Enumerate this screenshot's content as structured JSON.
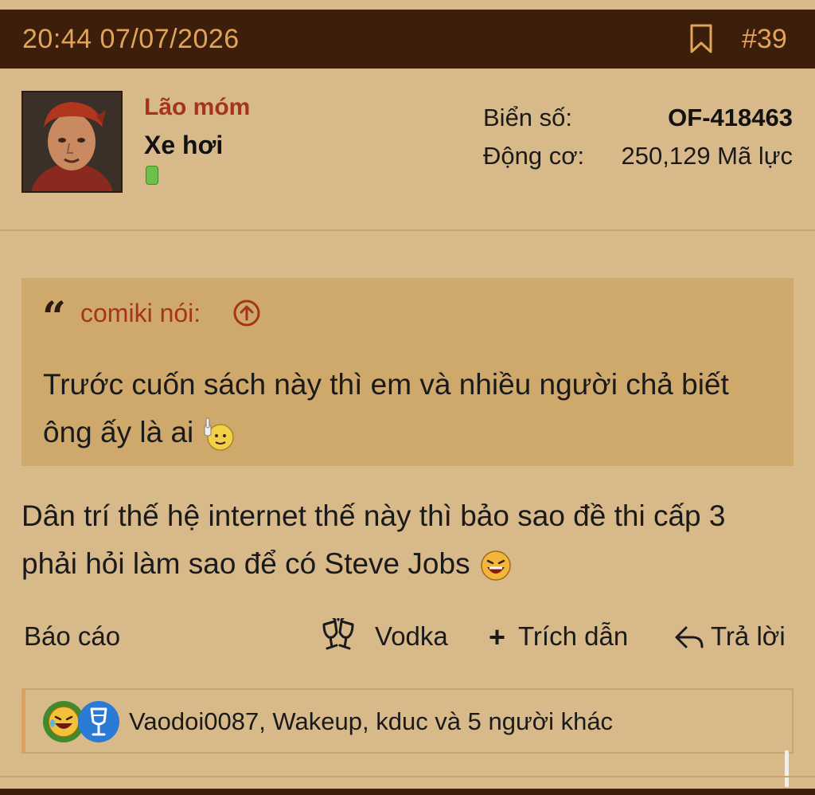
{
  "post": {
    "timestamp": "20:44 07/07/2026",
    "number": "#39"
  },
  "user": {
    "name": "Lão móm",
    "title": "Xe hơi",
    "online": true,
    "stats": [
      {
        "label": "Biển số:",
        "value": "OF-418463"
      },
      {
        "label": "Động cơ:",
        "value": "250,129 Mã lực"
      }
    ]
  },
  "quote": {
    "author": "comiki nói:",
    "text": "Trước cuốn sách này thì em và nhiều người chả biết ông ấy là ai"
  },
  "body": {
    "text": "Dân trí thế hệ internet thế này thì bảo sao đề thi cấp 3 phải hỏi làm sao để có Steve Jobs"
  },
  "actions": {
    "report": "Báo cáo",
    "vodka": "Vodka",
    "quote": "Trích dẫn",
    "reply": "Trả lời"
  },
  "reactions": {
    "summary": "Vaodoi0087, Wakeup, kduc và 5 người khác",
    "icons": [
      "laugh-reaction-icon",
      "wine-glass-reaction-icon"
    ]
  },
  "colors": {
    "header_bg": "#3d1e0a",
    "header_text": "#e0a55a",
    "page_bg": "#d8b98a",
    "quote_bg": "#cfa96c",
    "username": "#a6341d",
    "online": "#6cc04a"
  }
}
